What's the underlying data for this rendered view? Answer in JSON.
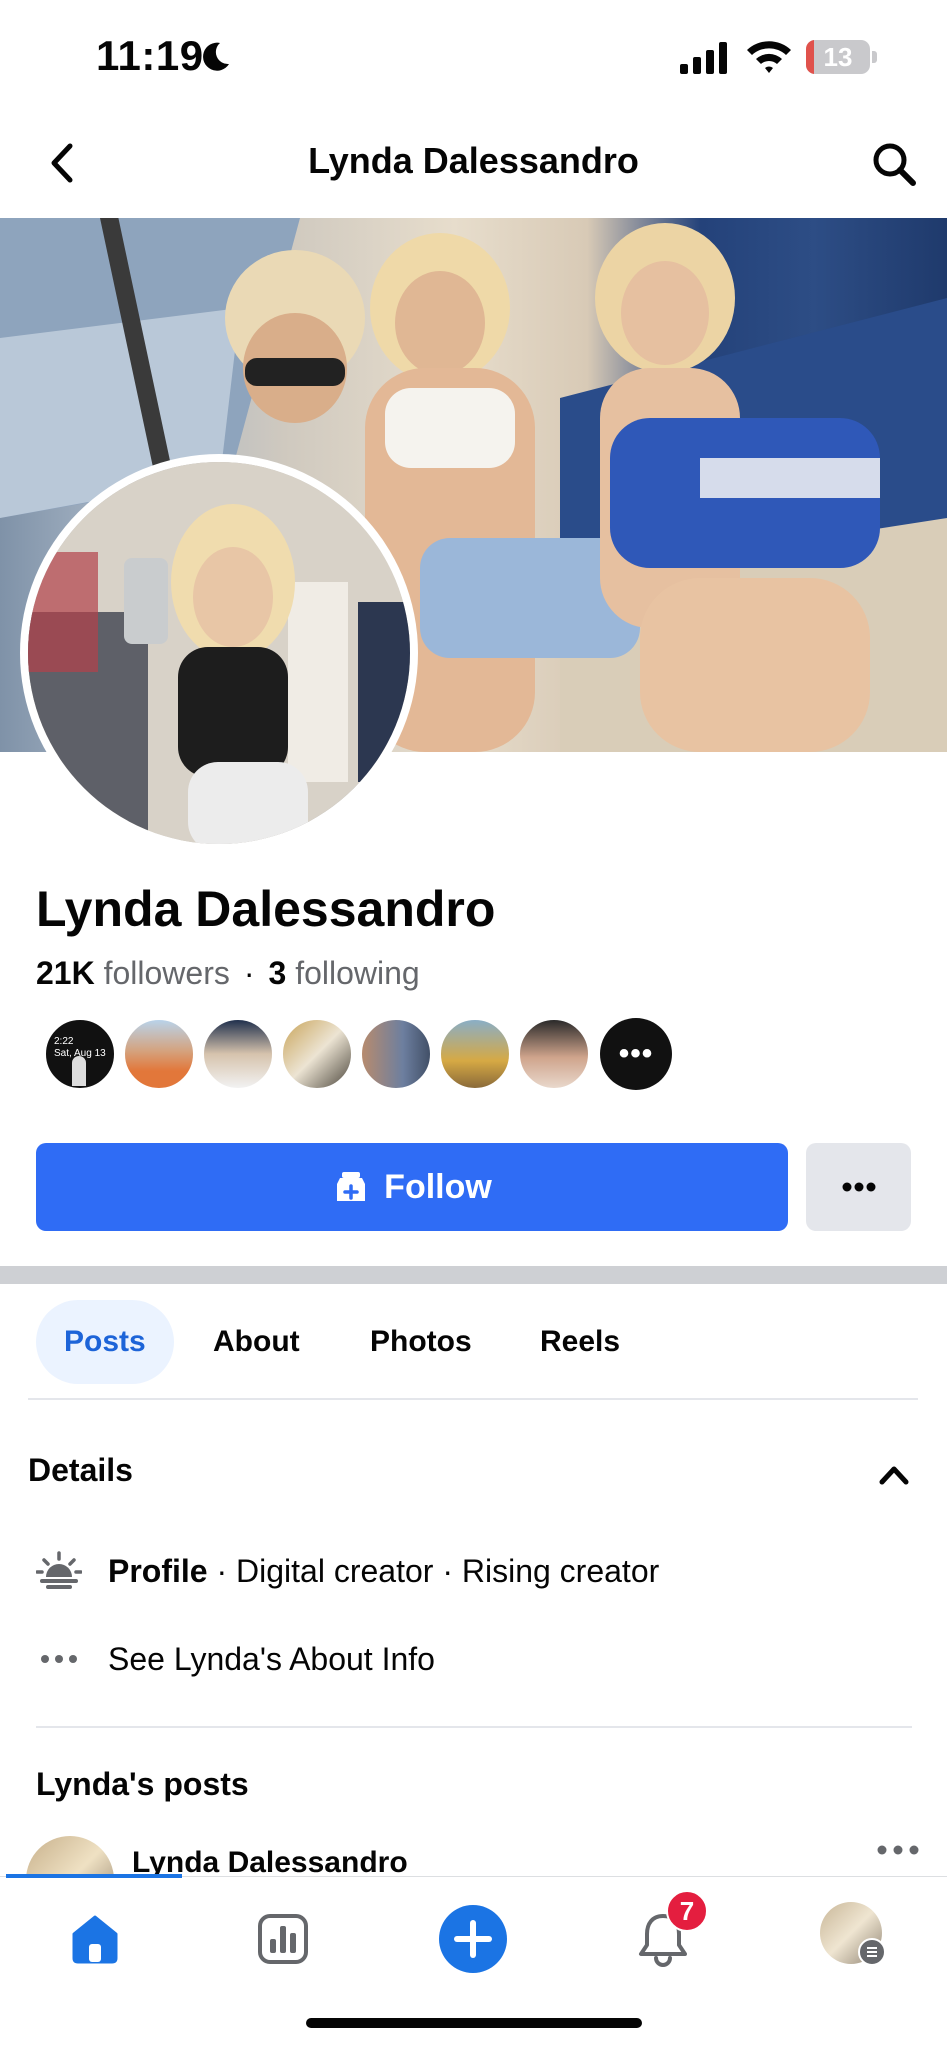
{
  "status_bar": {
    "time": "11:19",
    "battery_level": "13",
    "battery_fraction": 0.13,
    "battery_color": "#e0524c"
  },
  "header": {
    "title": "Lynda Dalessandro"
  },
  "profile": {
    "name": "Lynda Dalessandro",
    "followers_count": "21K",
    "followers_label": "followers",
    "following_count": "3",
    "following_label": "following",
    "mutual_friends_overflow": "•••",
    "follow_label": "Follow",
    "brand_color": "#2f6cf5",
    "friend_thumb_text": [
      "2:22",
      "Sat, Aug 13"
    ]
  },
  "tabs": [
    {
      "label": "Posts",
      "active": true
    },
    {
      "label": "About",
      "active": false
    },
    {
      "label": "Photos",
      "active": false
    },
    {
      "label": "Reels",
      "active": false
    }
  ],
  "details": {
    "title": "Details",
    "category_bold": "Profile",
    "category_rest": " · Digital creator · Rising creator",
    "about_link": "See Lynda's About Info"
  },
  "posts": {
    "title": "Lynda's posts",
    "first_post_author": "Lynda Dalessandro"
  },
  "bottom_nav": {
    "items": [
      "home-icon",
      "insights-icon",
      "create-icon",
      "notifications-icon",
      "profile-menu"
    ],
    "notification_count": "7"
  }
}
